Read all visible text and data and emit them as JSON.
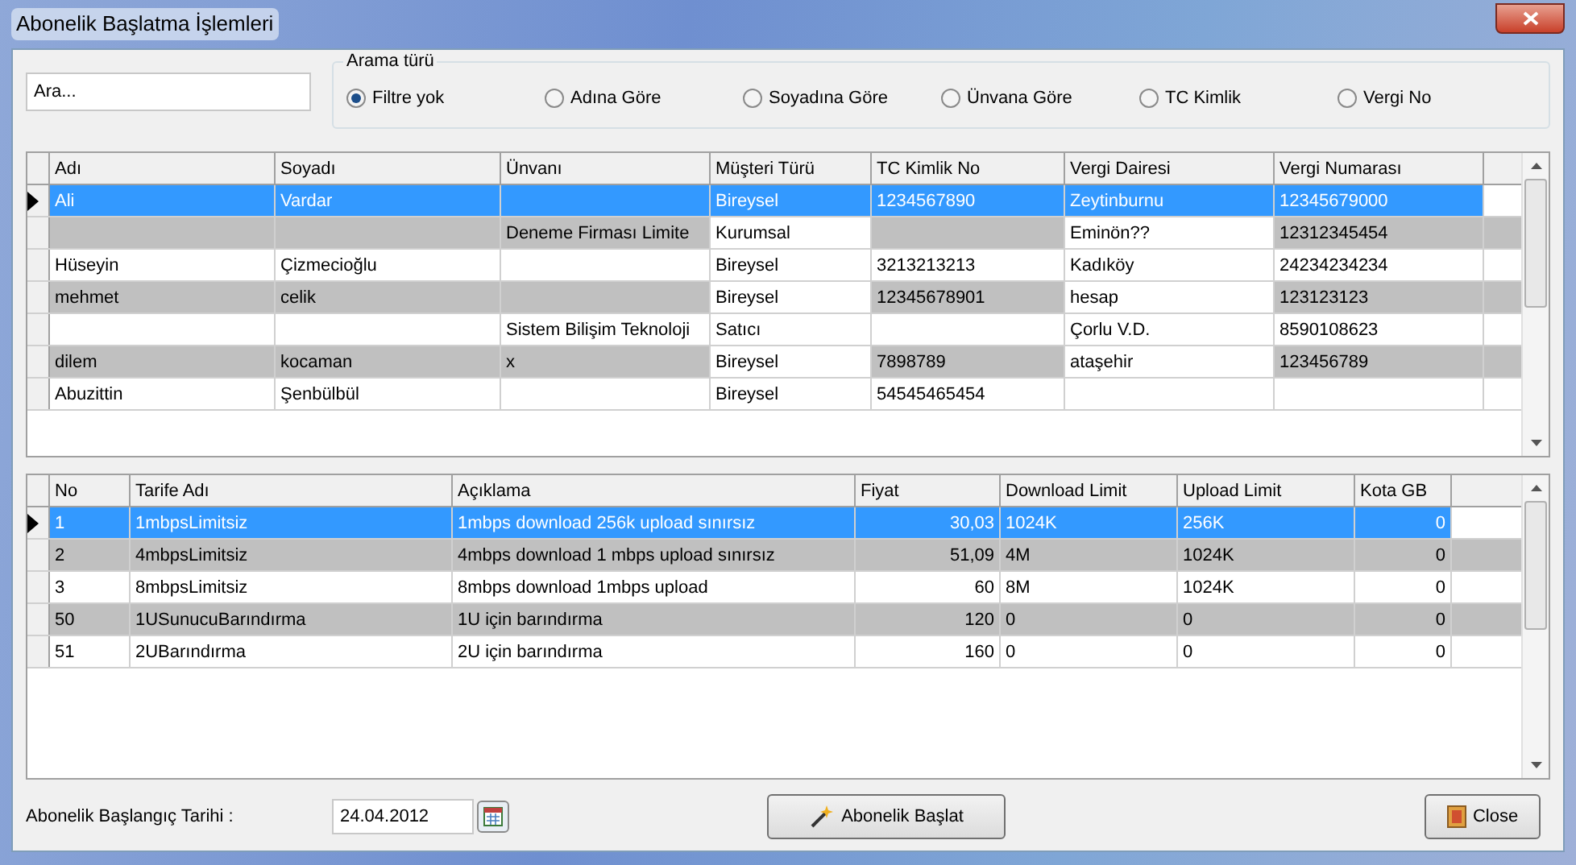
{
  "window": {
    "title": "Abonelik Başlatma İşlemleri"
  },
  "search": {
    "placeholder": "Ara..."
  },
  "search_type": {
    "title": "Arama türü",
    "options": [
      {
        "label": "Filtre yok",
        "selected": true
      },
      {
        "label": "Adına Göre",
        "selected": false
      },
      {
        "label": "Soyadına Göre",
        "selected": false
      },
      {
        "label": "Ünvana Göre",
        "selected": false
      },
      {
        "label": "TC Kimlik",
        "selected": false
      },
      {
        "label": "Vergi No",
        "selected": false
      }
    ]
  },
  "customers": {
    "columns": [
      {
        "label": "Adı",
        "plain": false
      },
      {
        "label": "Soyadı",
        "plain": false
      },
      {
        "label": "Ünvanı",
        "plain": false
      },
      {
        "label": "Müşteri Türü",
        "plain": true
      },
      {
        "label": "TC Kimlik No",
        "plain": false
      },
      {
        "label": "Vergi Dairesi",
        "plain": true
      },
      {
        "label": "Vergi Numarası",
        "plain": false
      }
    ],
    "rows": [
      {
        "selected": true,
        "shaded": false,
        "cells": [
          "Ali",
          "Vardar",
          "",
          "Bireysel",
          "1234567890",
          "Zeytinburnu",
          "12345679000"
        ]
      },
      {
        "selected": false,
        "shaded": true,
        "cells": [
          "",
          "",
          "Deneme Firması Limite",
          "Kurumsal",
          "",
          "Eminön??",
          "12312345454"
        ]
      },
      {
        "selected": false,
        "shaded": false,
        "cells": [
          "Hüseyin",
          "Çizmecioğlu",
          "",
          "Bireysel",
          "3213213213",
          "Kadıköy",
          "24234234234"
        ]
      },
      {
        "selected": false,
        "shaded": true,
        "cells": [
          "mehmet",
          "celik",
          "",
          "Bireysel",
          "12345678901",
          "hesap",
          "123123123"
        ]
      },
      {
        "selected": false,
        "shaded": false,
        "cells": [
          "",
          "",
          "Sistem Bilişim Teknoloji",
          "Satıcı",
          "",
          "Çorlu V.D.",
          "8590108623"
        ]
      },
      {
        "selected": false,
        "shaded": true,
        "cells": [
          "dilem",
          "kocaman",
          "x",
          "Bireysel",
          "7898789",
          "ataşehir",
          "123456789"
        ]
      },
      {
        "selected": false,
        "shaded": false,
        "cells": [
          "Abuzittin",
          "Şenbülbül",
          "",
          "Bireysel",
          "54545465454",
          "",
          ""
        ]
      }
    ]
  },
  "tariffs": {
    "columns": [
      {
        "label": "No",
        "plain": false
      },
      {
        "label": "Tarife Adı",
        "plain": false
      },
      {
        "label": "Açıklama",
        "plain": false
      },
      {
        "label": "Fiyat",
        "plain": false
      },
      {
        "label": "Download Limit",
        "plain": false
      },
      {
        "label": "Upload Limit",
        "plain": false
      },
      {
        "label": "Kota GB",
        "plain": false
      }
    ],
    "rows": [
      {
        "selected": true,
        "shaded": false,
        "cells": [
          "1",
          "1mbpsLimitsiz",
          "1mbps download 256k upload sınırsız",
          "30,03",
          "1024K",
          "256K",
          "0"
        ]
      },
      {
        "selected": false,
        "shaded": true,
        "cells": [
          "2",
          "4mbpsLimitsiz",
          "4mbps download 1 mbps upload sınırsız",
          "51,09",
          "4M",
          "1024K",
          "0"
        ]
      },
      {
        "selected": false,
        "shaded": false,
        "cells": [
          "3",
          "8mbpsLimitsiz",
          "8mbps download 1mbps upload",
          "60",
          "8M",
          "1024K",
          "0"
        ]
      },
      {
        "selected": false,
        "shaded": true,
        "cells": [
          "50",
          "1USunucuBarındırma",
          "1U için barındırma",
          "120",
          "0",
          "0",
          "0"
        ]
      },
      {
        "selected": false,
        "shaded": false,
        "cells": [
          "51",
          "2UBarındırma",
          "2U için barındırma",
          "160",
          "0",
          "0",
          "0"
        ]
      }
    ]
  },
  "start_date": {
    "label": "Abonelik Başlangıç Tarihi :",
    "value": "24.04.2012"
  },
  "start_button": "Abonelik Başlat",
  "close_button": "Close"
}
